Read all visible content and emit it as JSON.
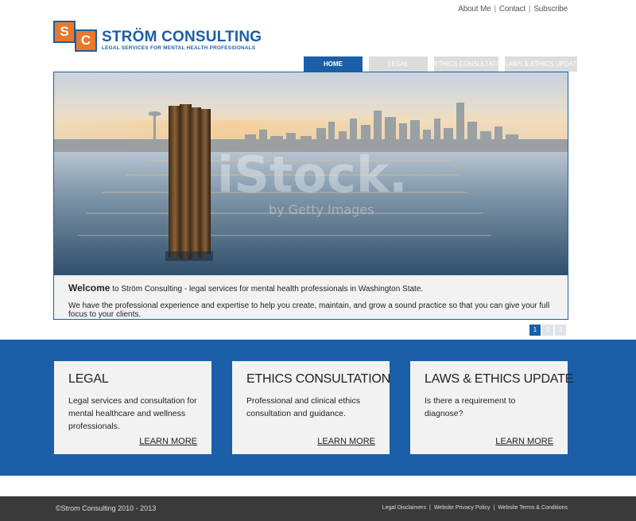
{
  "utility_links": [
    "About Me",
    "Contact",
    "Subscribe"
  ],
  "logo": {
    "letter1": "S",
    "letter2": "C",
    "name": "STRÖM CONSULTING",
    "tagline": "LEGAL SERVICES FOR MENTAL HEALTH PROFESSIONALS",
    "accent_color": "#e8782c",
    "brand_color": "#1a5fa8"
  },
  "nav": {
    "tabs": [
      "HOME",
      "LEGAL",
      "ETHICS CONSULTATION",
      "LAWS & ETHICS UPDATE"
    ],
    "active": "HOME"
  },
  "hero": {
    "watermark": "iStock.",
    "watermark_sub": "by Getty Images",
    "welcome_bold": "Welcome",
    "welcome_rest": " to Ström Consulting - legal services for mental health professionals in Washington State.",
    "line2": "We have the professional experience and expertise to help you create, maintain, and grow a sound practice so that you can give your full focus to your clients."
  },
  "pager": [
    "1",
    "2",
    "3"
  ],
  "cards": [
    {
      "title": "LEGAL",
      "text": "Legal services and consultation for mental healthcare and wellness professionals.",
      "link": "LEARN MORE"
    },
    {
      "title": "ETHICS CONSULTATION",
      "text": "Professional and clinical ethics consultation and guidance.",
      "link": "LEARN MORE"
    },
    {
      "title": "LAWS & ETHICS UPDATE",
      "text": "Is there a requirement to diagnose?",
      "link": "LEARN MORE"
    }
  ],
  "footer": {
    "copyright": "©Strom Consulting 2010 - 2013",
    "links": [
      "Legal Disclaimers",
      "Website Privacy Policy",
      "Website Terms & Conditions"
    ]
  }
}
